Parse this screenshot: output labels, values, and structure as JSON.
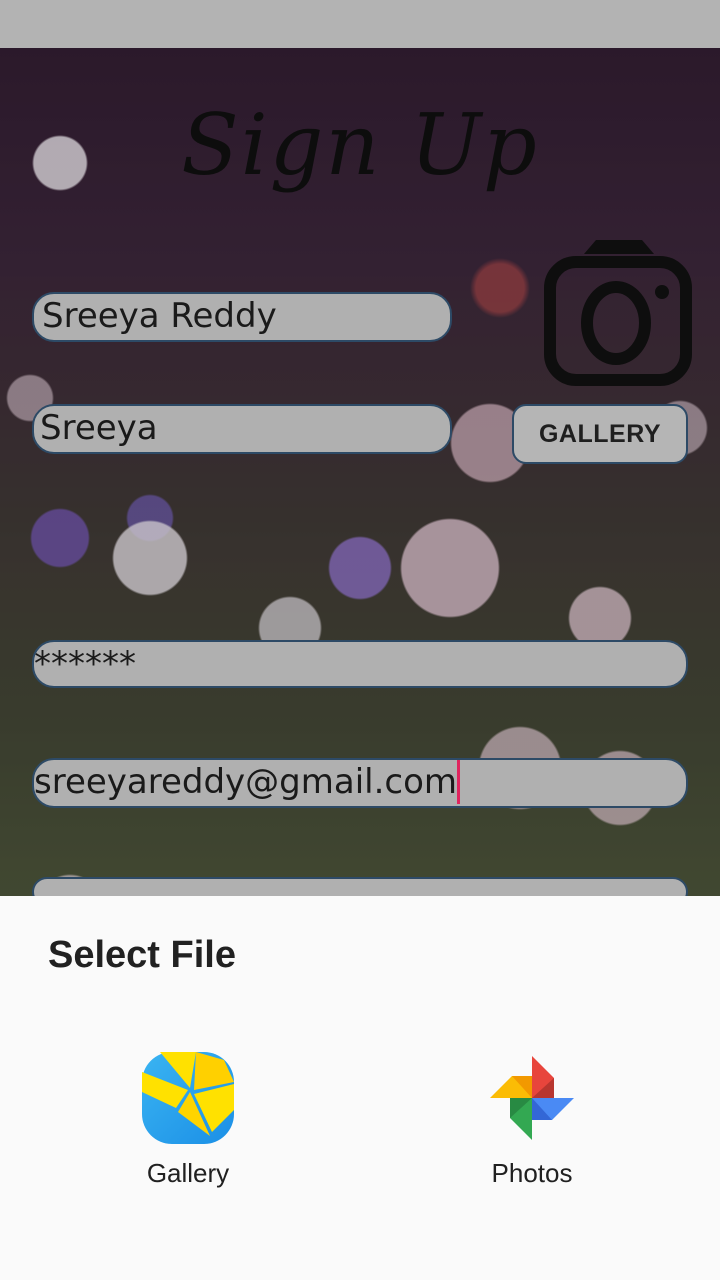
{
  "form": {
    "title": "Sign Up",
    "full_name_value": "Sreeya Reddy",
    "username_value": "Sreeya",
    "password_value": "******",
    "email_value": "sreeyareddy@gmail.com",
    "gallery_button_label": "GALLERY",
    "camera_icon": "camera-icon"
  },
  "chooser": {
    "title": "Select File",
    "options": [
      {
        "label": "Gallery",
        "icon": "gallery-app-icon"
      },
      {
        "label": "Photos",
        "icon": "google-photos-icon"
      }
    ]
  },
  "colors": {
    "field_fill": "#b0b0b0",
    "field_border": "#2d4a66",
    "caret": "#e0245e",
    "sheet_bg": "#fafafa"
  }
}
